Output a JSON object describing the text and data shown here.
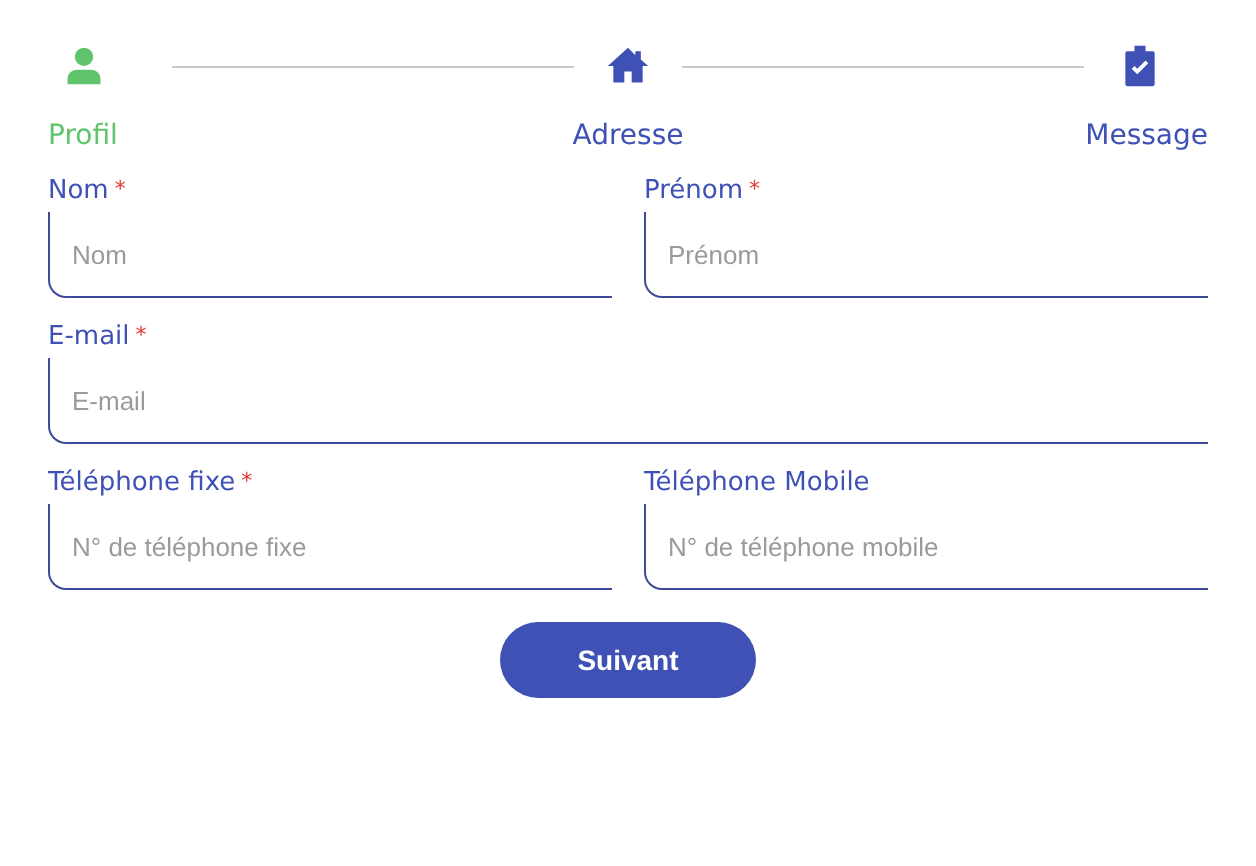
{
  "steps": [
    {
      "label": "Profil",
      "selected": true
    },
    {
      "label": "Adresse",
      "selected": false
    },
    {
      "label": "Message",
      "selected": false
    }
  ],
  "rows": [
    {
      "fields": [
        {
          "label": "Nom",
          "mark": "*",
          "placeholder": "Nom"
        },
        {
          "label": "Prénom",
          "mark": "*",
          "placeholder": "Prénom"
        }
      ]
    },
    {
      "fields": [
        {
          "label": "E-mail",
          "mark": "*",
          "placeholder": "E-mail"
        }
      ]
    },
    {
      "fields": [
        {
          "label": "Téléphone fixe",
          "mark": "*",
          "placeholder": "N° de téléphone fixe"
        },
        {
          "label": "Téléphone Mobile",
          "placeholder": "N° de téléphone mobile"
        }
      ]
    }
  ],
  "button": "Suivant"
}
